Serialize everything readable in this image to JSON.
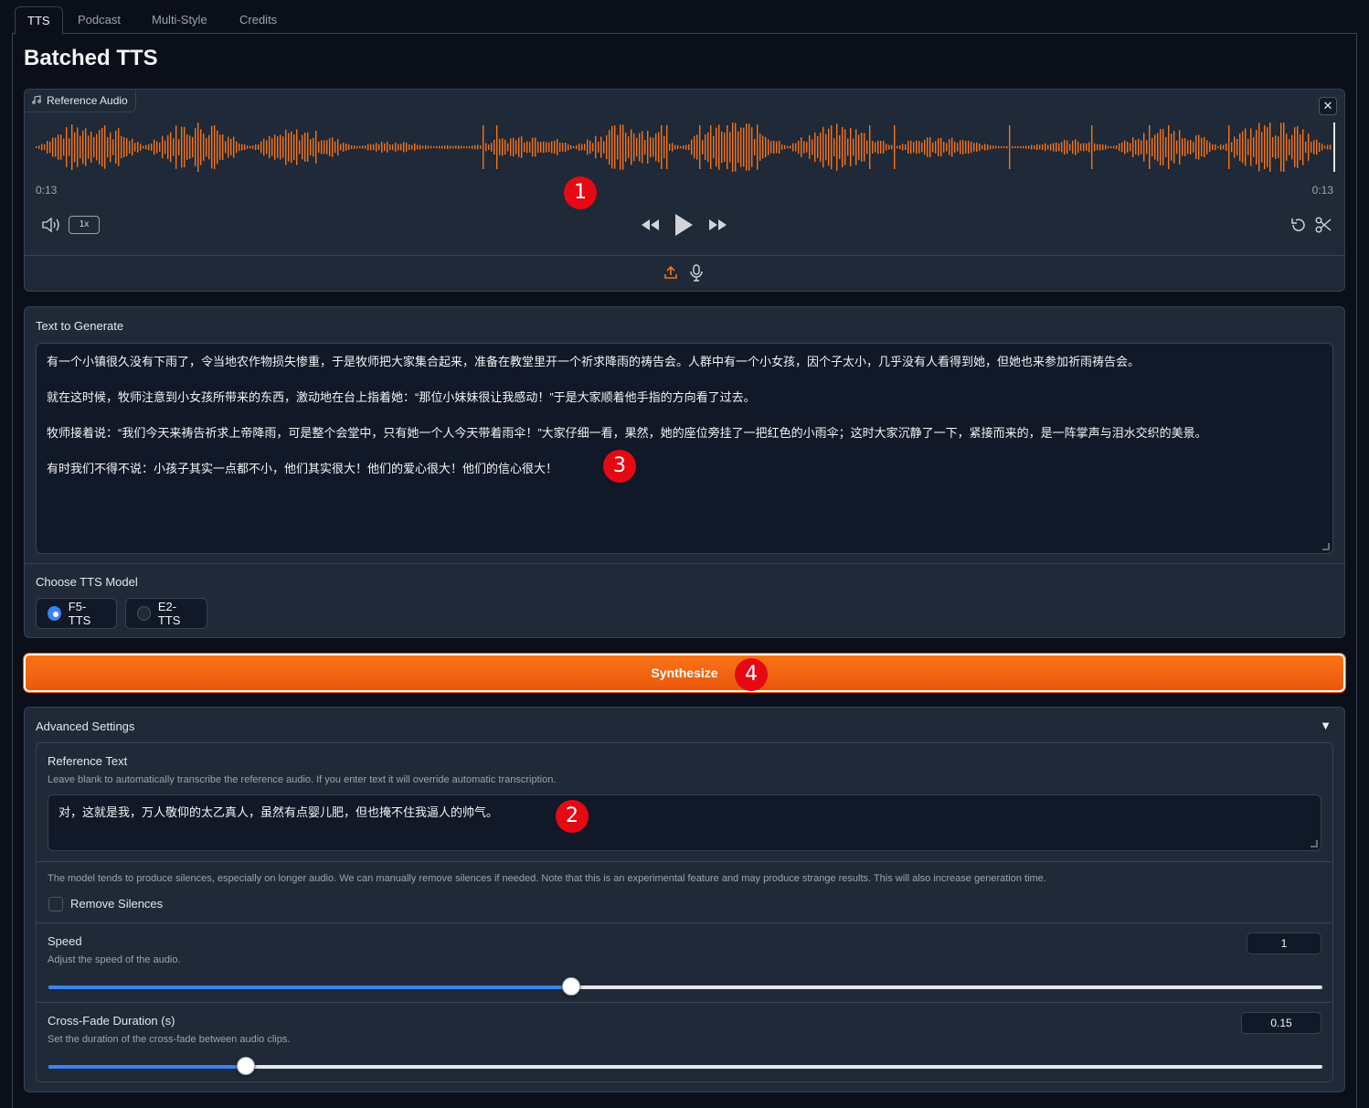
{
  "tabs": [
    {
      "label": "TTS",
      "active": true
    },
    {
      "label": "Podcast",
      "active": false
    },
    {
      "label": "Multi-Style",
      "active": false
    },
    {
      "label": "Credits",
      "active": false
    }
  ],
  "page_title": "Batched TTS",
  "reference_audio": {
    "label": "Reference Audio",
    "time_current": "0:13",
    "time_total": "0:13",
    "playback_speed": "1x",
    "waveform_color": "#f97316"
  },
  "text_to_generate": {
    "label": "Text to Generate",
    "paragraphs": [
      "有一个小镇很久没有下雨了，令当地农作物损失惨重，于是牧师把大家集合起来，准备在教堂里开一个祈求降雨的祷告会。人群中有一个小女孩，因个子太小，几乎没有人看得到她，但她也来参加祈雨祷告会。",
      "就在这时候，牧师注意到小女孩所带来的东西，激动地在台上指着她：“那位小妹妹很让我感动！”于是大家顺着他手指的方向看了过去。",
      "牧师接着说：“我们今天来祷告祈求上帝降雨，可是整个会堂中，只有她一个人今天带着雨伞！”大家仔细一看，果然，她的座位旁挂了一把红色的小雨伞；这时大家沉静了一下，紧接而来的，是一阵掌声与泪水交织的美景。",
      "有时我们不得不说：小孩子其实一点都不小，他们其实很大！他们的爱心很大！他们的信心很大！"
    ]
  },
  "model": {
    "label": "Choose TTS Model",
    "options": [
      "F5-TTS",
      "E2-TTS"
    ],
    "selected": "F5-TTS"
  },
  "synthesize_label": "Synthesize",
  "advanced": {
    "label": "Advanced Settings",
    "toggle_icon": "▼",
    "reference_text": {
      "label": "Reference Text",
      "info": "Leave blank to automatically transcribe the reference audio. If you enter text it will override automatic transcription.",
      "value": "对，这就是我，万人敬仰的太乙真人，虽然有点婴儿肥，但也掩不住我逼人的帅气。"
    },
    "silence_info": "The model tends to produce silences, especially on longer audio. We can manually remove silences if needed. Note that this is an experimental feature and may produce strange results. This will also increase generation time.",
    "remove_silences": {
      "label": "Remove Silences",
      "checked": false
    },
    "speed": {
      "label": "Speed",
      "info": "Adjust the speed of the audio.",
      "value": "1",
      "fraction": 0.41
    },
    "crossfade": {
      "label": "Cross-Fade Duration (s)",
      "info": "Set the duration of the cross-fade between audio clips.",
      "value": "0.15",
      "fraction": 0.155
    }
  },
  "markers": [
    "1",
    "2",
    "3",
    "4"
  ],
  "colors": {
    "accent": "#f97316",
    "slider": "#3b82f6",
    "marker": "#e50914"
  }
}
